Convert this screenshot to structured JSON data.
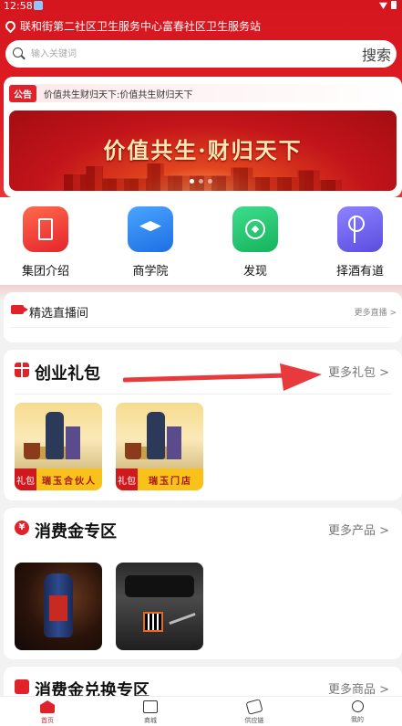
{
  "status_bar": {
    "time": "12:58"
  },
  "location": "联和街第二社区卫生服务中心富春社区卫生服务站",
  "search": {
    "placeholder": "输入关键词",
    "button": "搜索"
  },
  "notice": {
    "tag": "公告",
    "text": "价值共生财归天下:价值共生财归天下"
  },
  "banner": {
    "title": "价值共生·财归天下",
    "dot_count": 3,
    "active_dot": 0
  },
  "quick_nav": [
    {
      "label": "集团介绍",
      "icon": "building-icon"
    },
    {
      "label": "商学院",
      "icon": "graduation-cap-icon"
    },
    {
      "label": "发现",
      "icon": "compass-icon"
    },
    {
      "label": "择酒有道",
      "icon": "flower-icon"
    }
  ],
  "live": {
    "title": "精选直播间",
    "more": "更多直播 >"
  },
  "gift_pack": {
    "title": "创业礼包",
    "more": "更多礼包 >",
    "items": [
      {
        "tag": "礼包",
        "name": "瑞玉合伙人"
      },
      {
        "tag": "礼包",
        "name": "瑞玉门店"
      }
    ]
  },
  "consumer_zone": {
    "title": "消费金专区",
    "icon_char": "¥",
    "more": "更多产品 >"
  },
  "exchange_zone": {
    "title": "消费金兑换专区",
    "more": "更多商品 >"
  },
  "tab_bar": [
    {
      "label": "首页",
      "icon": "home-icon",
      "active": true
    },
    {
      "label": "商城",
      "icon": "shop-icon",
      "active": false
    },
    {
      "label": "供应链",
      "icon": "chain-icon",
      "active": false
    },
    {
      "label": "我的",
      "icon": "user-icon",
      "active": false
    }
  ],
  "colors": {
    "brand_red": "#e0232b",
    "gold": "#f8c21a"
  }
}
